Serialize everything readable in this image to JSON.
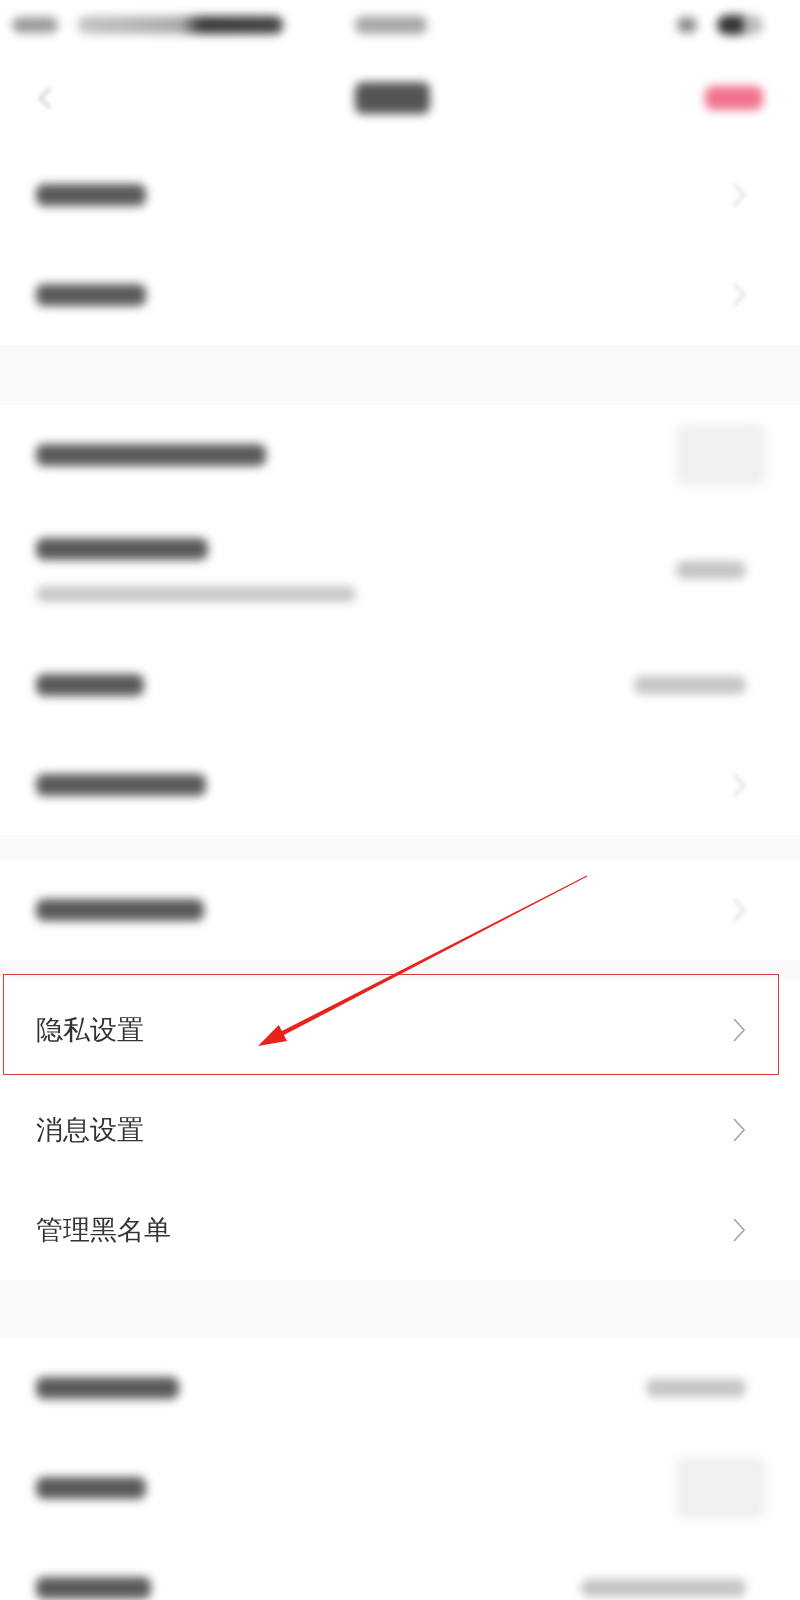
{
  "status_bar": {
    "kind": "blurred"
  },
  "header": {
    "kind": "blurred"
  },
  "sections": [
    {
      "rows": [
        {
          "kind": "blurred",
          "accessory": {
            "kind": "chevron"
          }
        },
        {
          "kind": "blurred",
          "accessory": {
            "kind": "chevron"
          }
        }
      ]
    },
    {
      "rows": [
        {
          "kind": "blurred",
          "accessory": {
            "kind": "blurred_block"
          }
        },
        {
          "kind": "blurred_two_line",
          "accessory": {
            "kind": "blurred_value"
          }
        },
        {
          "kind": "blurred",
          "accessory": {
            "kind": "blurred_value"
          }
        },
        {
          "kind": "blurred",
          "accessory": {
            "kind": "chevron"
          }
        }
      ]
    },
    {
      "rows": [
        {
          "kind": "blurred",
          "accessory": {
            "kind": "chevron"
          }
        }
      ]
    },
    {
      "rows": [
        {
          "kind": "link",
          "label": "隐私设置",
          "highlighted": true
        },
        {
          "kind": "link",
          "label": "消息设置",
          "highlighted": false
        },
        {
          "kind": "link",
          "label": "管理黑名单",
          "highlighted": false
        }
      ]
    },
    {
      "rows": [
        {
          "kind": "blurred",
          "accessory": {
            "kind": "blurred_value"
          }
        },
        {
          "kind": "blurred",
          "accessory": {
            "kind": "blurred_block"
          }
        },
        {
          "kind": "blurred",
          "accessory": {
            "kind": "blurred_value"
          }
        }
      ]
    }
  ]
}
